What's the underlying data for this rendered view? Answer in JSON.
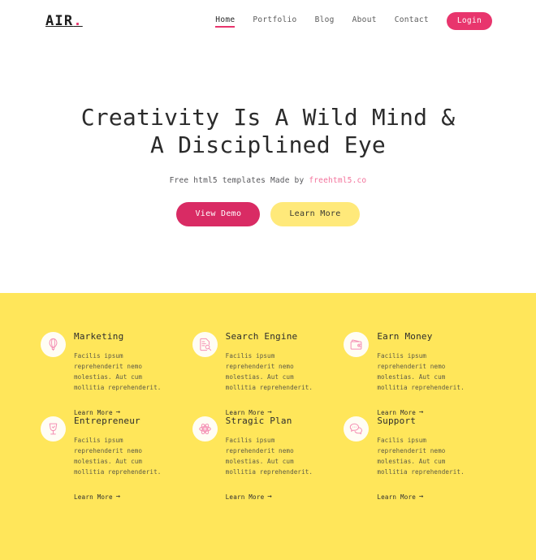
{
  "theme": {
    "pink": "#e8356d",
    "pink_light": "#f3729b",
    "yellow": "#ffe65a",
    "yellow_button": "#ffe97a",
    "dark_text": "#2b2b2b"
  },
  "header": {
    "brand": "AIR",
    "brand_dot": ".",
    "nav": [
      {
        "label": "Home",
        "active": true
      },
      {
        "label": "Portfolio",
        "active": false
      },
      {
        "label": "Blog",
        "active": false
      },
      {
        "label": "About",
        "active": false
      },
      {
        "label": "Contact",
        "active": false
      }
    ],
    "login_label": "Login"
  },
  "hero": {
    "title_line_1": "Creativity Is A Wild Mind &",
    "title_line_2": "A Disciplined Eye",
    "subtitle_prefix": "Free html5 templates Made by ",
    "subtitle_link": "freehtml5.co",
    "primary_button": "View Demo",
    "secondary_button": "Learn More"
  },
  "features": {
    "link_label": "Learn More",
    "link_arrow": "→",
    "body_text": "Facilis ipsum reprehenderit nemo molestias. Aut cum mollitia reprehenderit.",
    "cards": [
      {
        "title": "Marketing",
        "icon": "hot-air-balloon-icon",
        "text": "Facilis ipsum reprehenderit nemo molestias. Aut cum mollitia reprehenderit.",
        "link": "Learn More"
      },
      {
        "title": "Search Engine",
        "icon": "document-search-icon",
        "text": "Facilis ipsum reprehenderit nemo molestias. Aut cum mollitia reprehenderit.",
        "link": "Learn More"
      },
      {
        "title": "Earn Money",
        "icon": "wallet-icon",
        "text": "Facilis ipsum reprehenderit nemo molestias. Aut cum mollitia reprehenderit.",
        "link": "Learn More"
      },
      {
        "title": "Entrepreneur",
        "icon": "wine-glass-icon",
        "text": "Facilis ipsum reprehenderit nemo molestias. Aut cum mollitia reprehenderit.",
        "link": "Learn More"
      },
      {
        "title": "Stragic Plan",
        "icon": "atom-icon",
        "text": "Facilis ipsum reprehenderit nemo molestias. Aut cum mollitia reprehenderit.",
        "link": "Learn More"
      },
      {
        "title": "Support",
        "icon": "chat-bubbles-icon",
        "text": "Facilis ipsum reprehenderit nemo molestias. Aut cum mollitia reprehenderit.",
        "link": "Learn More"
      }
    ]
  }
}
